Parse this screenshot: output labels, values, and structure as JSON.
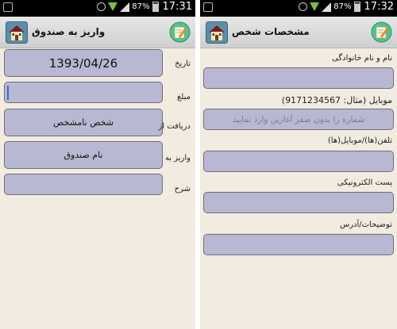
{
  "status_left": {
    "time": "17:31",
    "battery": "87%"
  },
  "status_right": {
    "time": "17:32",
    "battery": "87%"
  },
  "left": {
    "title": "واریز به صندوق",
    "fields": {
      "date": {
        "label": "تاریخ",
        "value": "1393/04/26"
      },
      "amount": {
        "label": "مبلغ",
        "value": ""
      },
      "from": {
        "label": "دریافت از",
        "value": "شخص نامشخص"
      },
      "to": {
        "label": "واریز به",
        "value": "نام صندوق"
      },
      "description": {
        "label": "شرح",
        "value": ""
      }
    }
  },
  "right": {
    "title": "مشخصات شخص",
    "fields": {
      "name": {
        "label": "نام و نام خانوادگی",
        "value": ""
      },
      "mobile": {
        "label": "موبایل (مثال: 9171234567)",
        "placeholder": "شماره را بدون صفر آغازین وارد نمایید"
      },
      "phones": {
        "label": "تلفن(ها)/موبایل(ها)",
        "value": ""
      },
      "email": {
        "label": "پست الکترونیکی",
        "value": ""
      },
      "notes": {
        "label": "توضیحات/آدرس",
        "value": ""
      }
    }
  },
  "icons": {
    "house": "house-icon",
    "edit": "edit-note-icon"
  },
  "colors": {
    "field_bg": "#b8b8d2",
    "screen_bg": "#f2ebe0",
    "accent_green": "#55c090"
  }
}
